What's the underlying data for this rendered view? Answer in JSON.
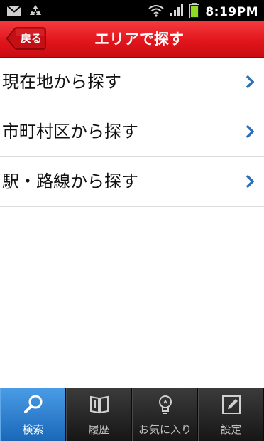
{
  "status_bar": {
    "time": "8:19PM",
    "icons": [
      "mail-icon",
      "recycle-icon",
      "wifi-icon",
      "signal-icon",
      "battery-icon"
    ]
  },
  "header": {
    "back_label": "戻る",
    "title": "エリアで探す",
    "color": "#e2151c"
  },
  "menu": {
    "items": [
      {
        "label": "現在地から探す",
        "icon": "chevron-right-icon"
      },
      {
        "label": "市町村区から探す",
        "icon": "chevron-right-icon"
      },
      {
        "label": "駅・路線から探す",
        "icon": "chevron-right-icon"
      }
    ],
    "chevron_color": "#2f6fb5"
  },
  "tab_bar": {
    "tabs": [
      {
        "label": "検索",
        "icon": "search-icon",
        "active": true
      },
      {
        "label": "履歴",
        "icon": "book-icon",
        "active": false
      },
      {
        "label": "お気に入り",
        "icon": "lightbulb-icon",
        "active": false
      },
      {
        "label": "設定",
        "icon": "edit-icon",
        "active": false
      }
    ],
    "active_color": "#2a7fd4"
  }
}
